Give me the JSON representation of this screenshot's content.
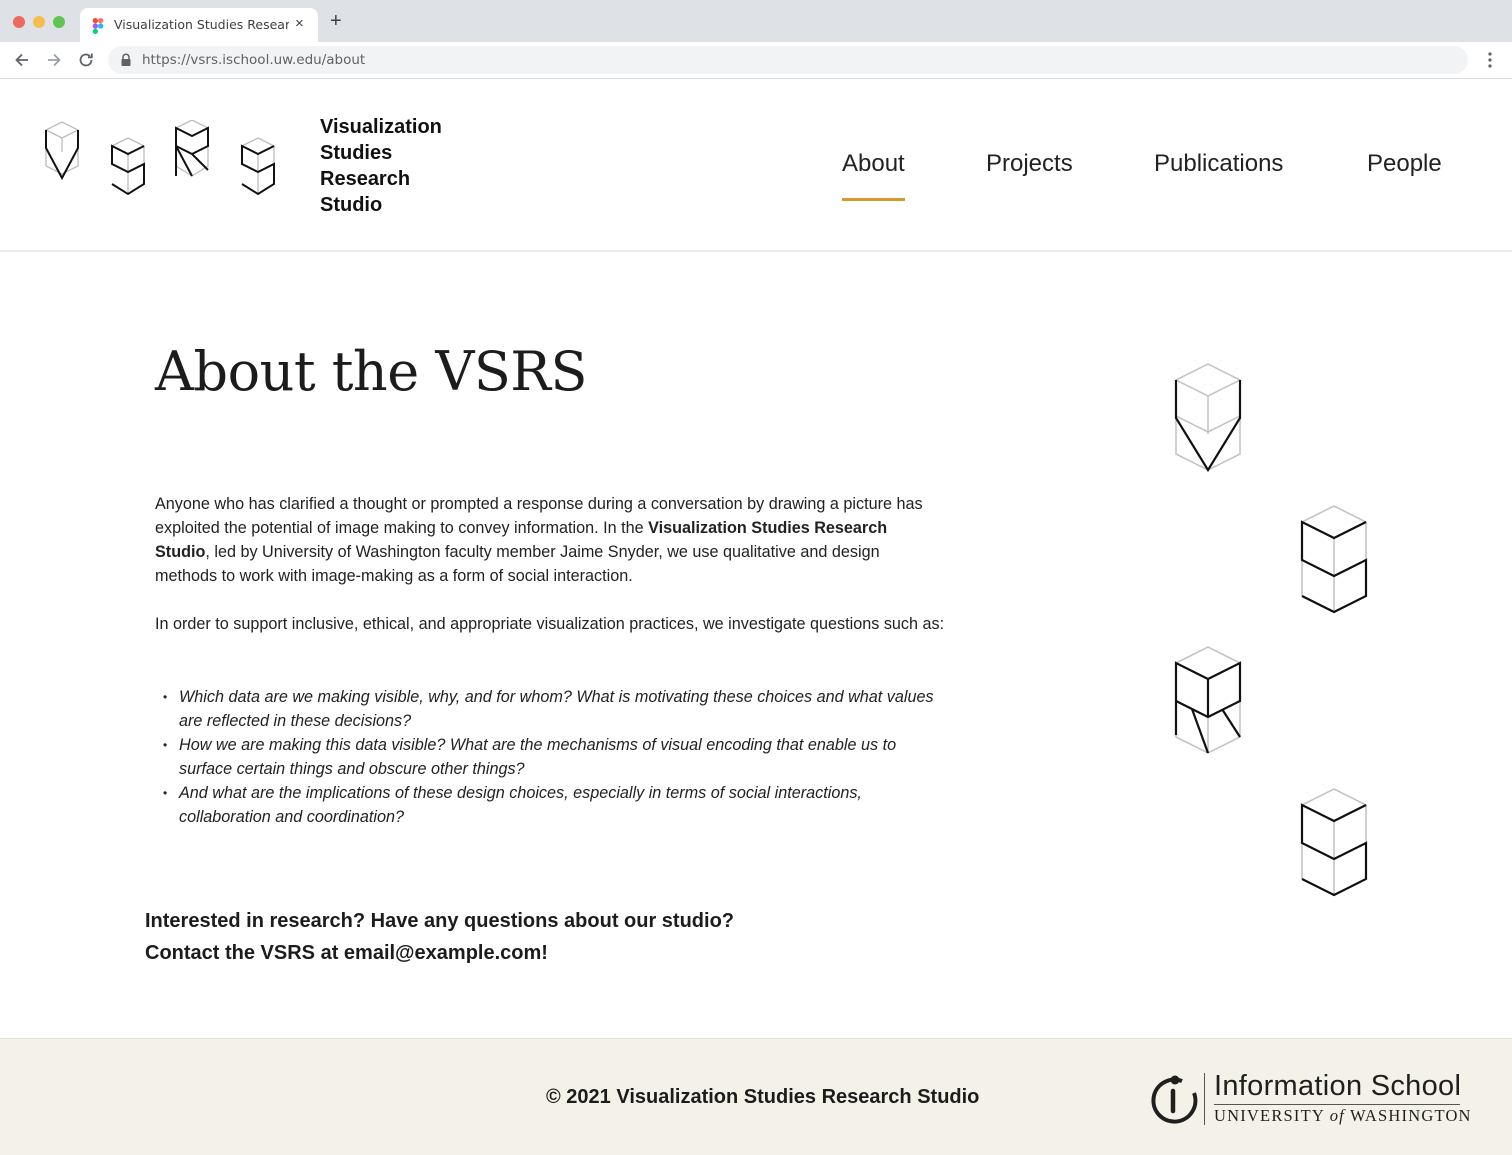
{
  "browser": {
    "tab_title": "Visualization Studies Research Studio",
    "new_tab": "+",
    "close": "×",
    "url": "https://vsrs.ischool.uw.edu/about"
  },
  "site": {
    "logo_lines": [
      "Visualization",
      "Studies",
      "Research",
      "Studio"
    ],
    "nav": [
      {
        "label": "About",
        "active": true
      },
      {
        "label": "Projects",
        "active": false
      },
      {
        "label": "Publications",
        "active": false
      },
      {
        "label": "People",
        "active": false
      }
    ],
    "accent_color": "#d89a2b"
  },
  "main": {
    "title": "About the VSRS",
    "intro_before_bold": "Anyone who has clarified a thought or prompted a response during a conversation by drawing a picture has exploited the potential of image making to convey information. In the ",
    "intro_bold": "Visualization Studies Research Studio",
    "intro_after_bold": ", led by University of Washington faculty member Jaime Snyder, we use qualitative and design methods to work with image-making as a form of social interaction.",
    "questions_intro": "In order to support inclusive, ethical, and appropriate visualization practices, we investigate questions such as:",
    "questions": [
      "Which data are we making visible, why, and for whom? What is motivating these choices and what values are reflected in these decisions?",
      "How we are making this data visible? What are the mechanisms of visual encoding that enable us to surface certain things and obscure other things?",
      "And what are the implications of these design choices, especially in terms of social interactions, collaboration and coordination?"
    ],
    "contact_line1": "Interested in research? Have any questions about our studio?",
    "contact_line2": "Contact the VSRS at email@example.com!"
  },
  "footer": {
    "copyright": "© 2021 Visualization Studies Research Studio",
    "ischool_name": "Information School",
    "university_part1": "UNIVERSITY",
    "university_of": "of",
    "university_part2": "WASHINGTON",
    "background": "#f4f2e8"
  }
}
